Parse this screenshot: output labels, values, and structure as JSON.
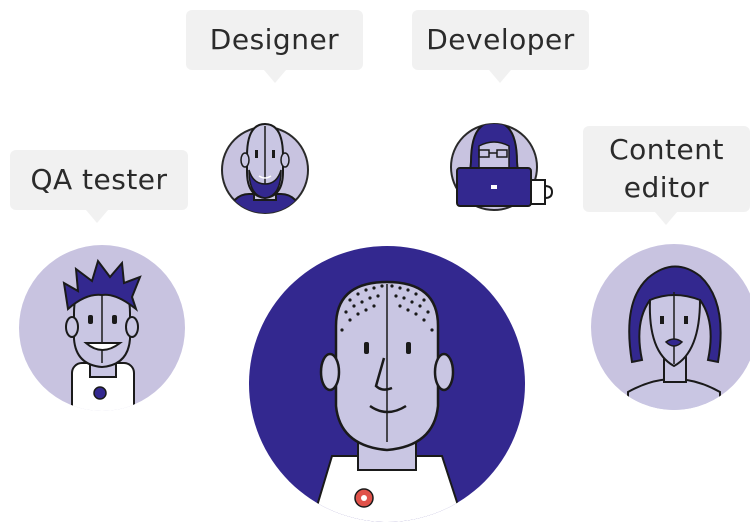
{
  "roles": {
    "designer": "Designer",
    "developer": "Developer",
    "qa_tester": "QA tester",
    "content_editor_line1": "Content",
    "content_editor_line2": "editor"
  },
  "colors": {
    "navy": "#33288f",
    "lavender": "#c8c3e0",
    "face": "#c9c6e3",
    "bubble": "#f1f1f1",
    "text": "#2b2b2b",
    "accent_red": "#e0524a"
  }
}
